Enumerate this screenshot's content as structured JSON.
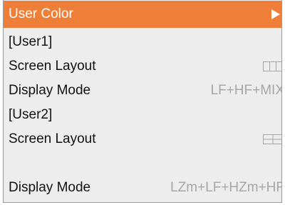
{
  "menu": {
    "header": {
      "label": "User Color",
      "arrow_icon": "triangle-right-icon"
    },
    "items": [
      {
        "label": "[User1]"
      },
      {
        "label": "Screen Layout",
        "icon": "three-column-layout-icon"
      },
      {
        "label": "Display Mode",
        "value": "LF+HF+MIX"
      },
      {
        "label": "[User2]"
      },
      {
        "label": "Screen Layout",
        "icon": "two-by-two-layout-icon"
      },
      {
        "label": "Display Mode",
        "value": "LZm+LF+HZm+HF"
      }
    ]
  },
  "colors": {
    "header_bg": "#ef7f38",
    "menu_bg": "#ededed",
    "value_text": "#a6a6a6"
  }
}
